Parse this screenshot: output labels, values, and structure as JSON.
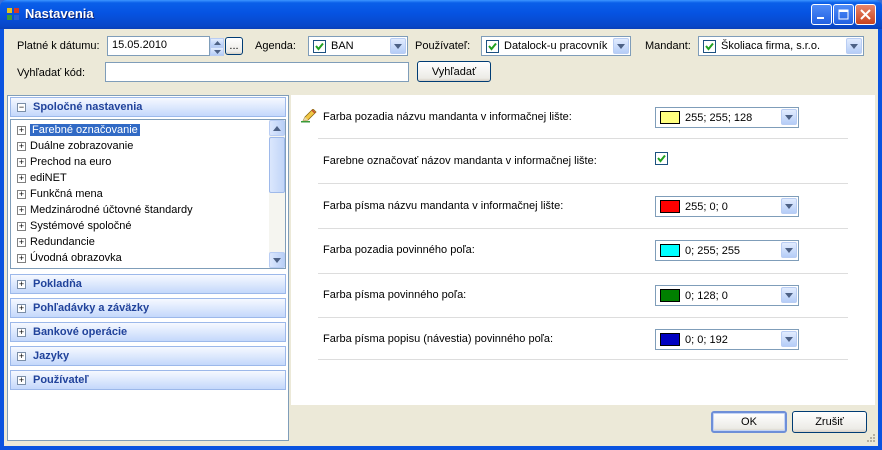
{
  "window": {
    "title": "Nastavenia"
  },
  "toolbar": {
    "date_label": "Platné k dátumu:",
    "date_value": "15.05.2010",
    "ellipsis": "...",
    "agenda_label": "Agenda:",
    "agenda_value": "BAN",
    "user_label": "Používateľ:",
    "user_value": "Datalock-u pracovník",
    "mandant_label": "Mandant:",
    "mandant_value": "Školiaca firma, s.r.o.",
    "search_label": "Vyhľadať kód:",
    "search_value": "",
    "search_button": "Vyhľadať"
  },
  "sidebar": {
    "active_section": "Spoločné nastavenia",
    "tree_items": [
      "Farebné označovanie",
      "Duálne zobrazovanie",
      "Prechod na euro",
      "ediNET",
      "Funkčná mena",
      "Medzinárodné účtovné štandardy",
      "Systémové spoločné",
      "Redundancie",
      "Úvodná obrazovka"
    ],
    "sections": [
      "Pokladňa",
      "Pohľadávky a záväzky",
      "Bankové operácie",
      "Jazyky",
      "Používateľ"
    ]
  },
  "settings": [
    {
      "label": "Farba pozadia názvu mandanta v informačnej lište:",
      "value": "255; 255; 128",
      "color": "#ffff80"
    },
    {
      "label": "Farebne označovať názov mandanta v informačnej lište:",
      "checked": true
    },
    {
      "label": "Farba písma názvu mandanta v informačnej lište:",
      "value": "255; 0; 0",
      "color": "#ff0000"
    },
    {
      "label": "Farba pozadia povinného poľa:",
      "value": "0; 255; 255",
      "color": "#00ffff"
    },
    {
      "label": "Farba písma povinného poľa:",
      "value": "0; 128; 0",
      "color": "#008000"
    },
    {
      "label": "Farba písma popisu (návestia) povinného poľa:",
      "value": "0; 0; 192",
      "color": "#0000c0"
    }
  ],
  "footer": {
    "ok": "OK",
    "cancel": "Zrušiť"
  }
}
